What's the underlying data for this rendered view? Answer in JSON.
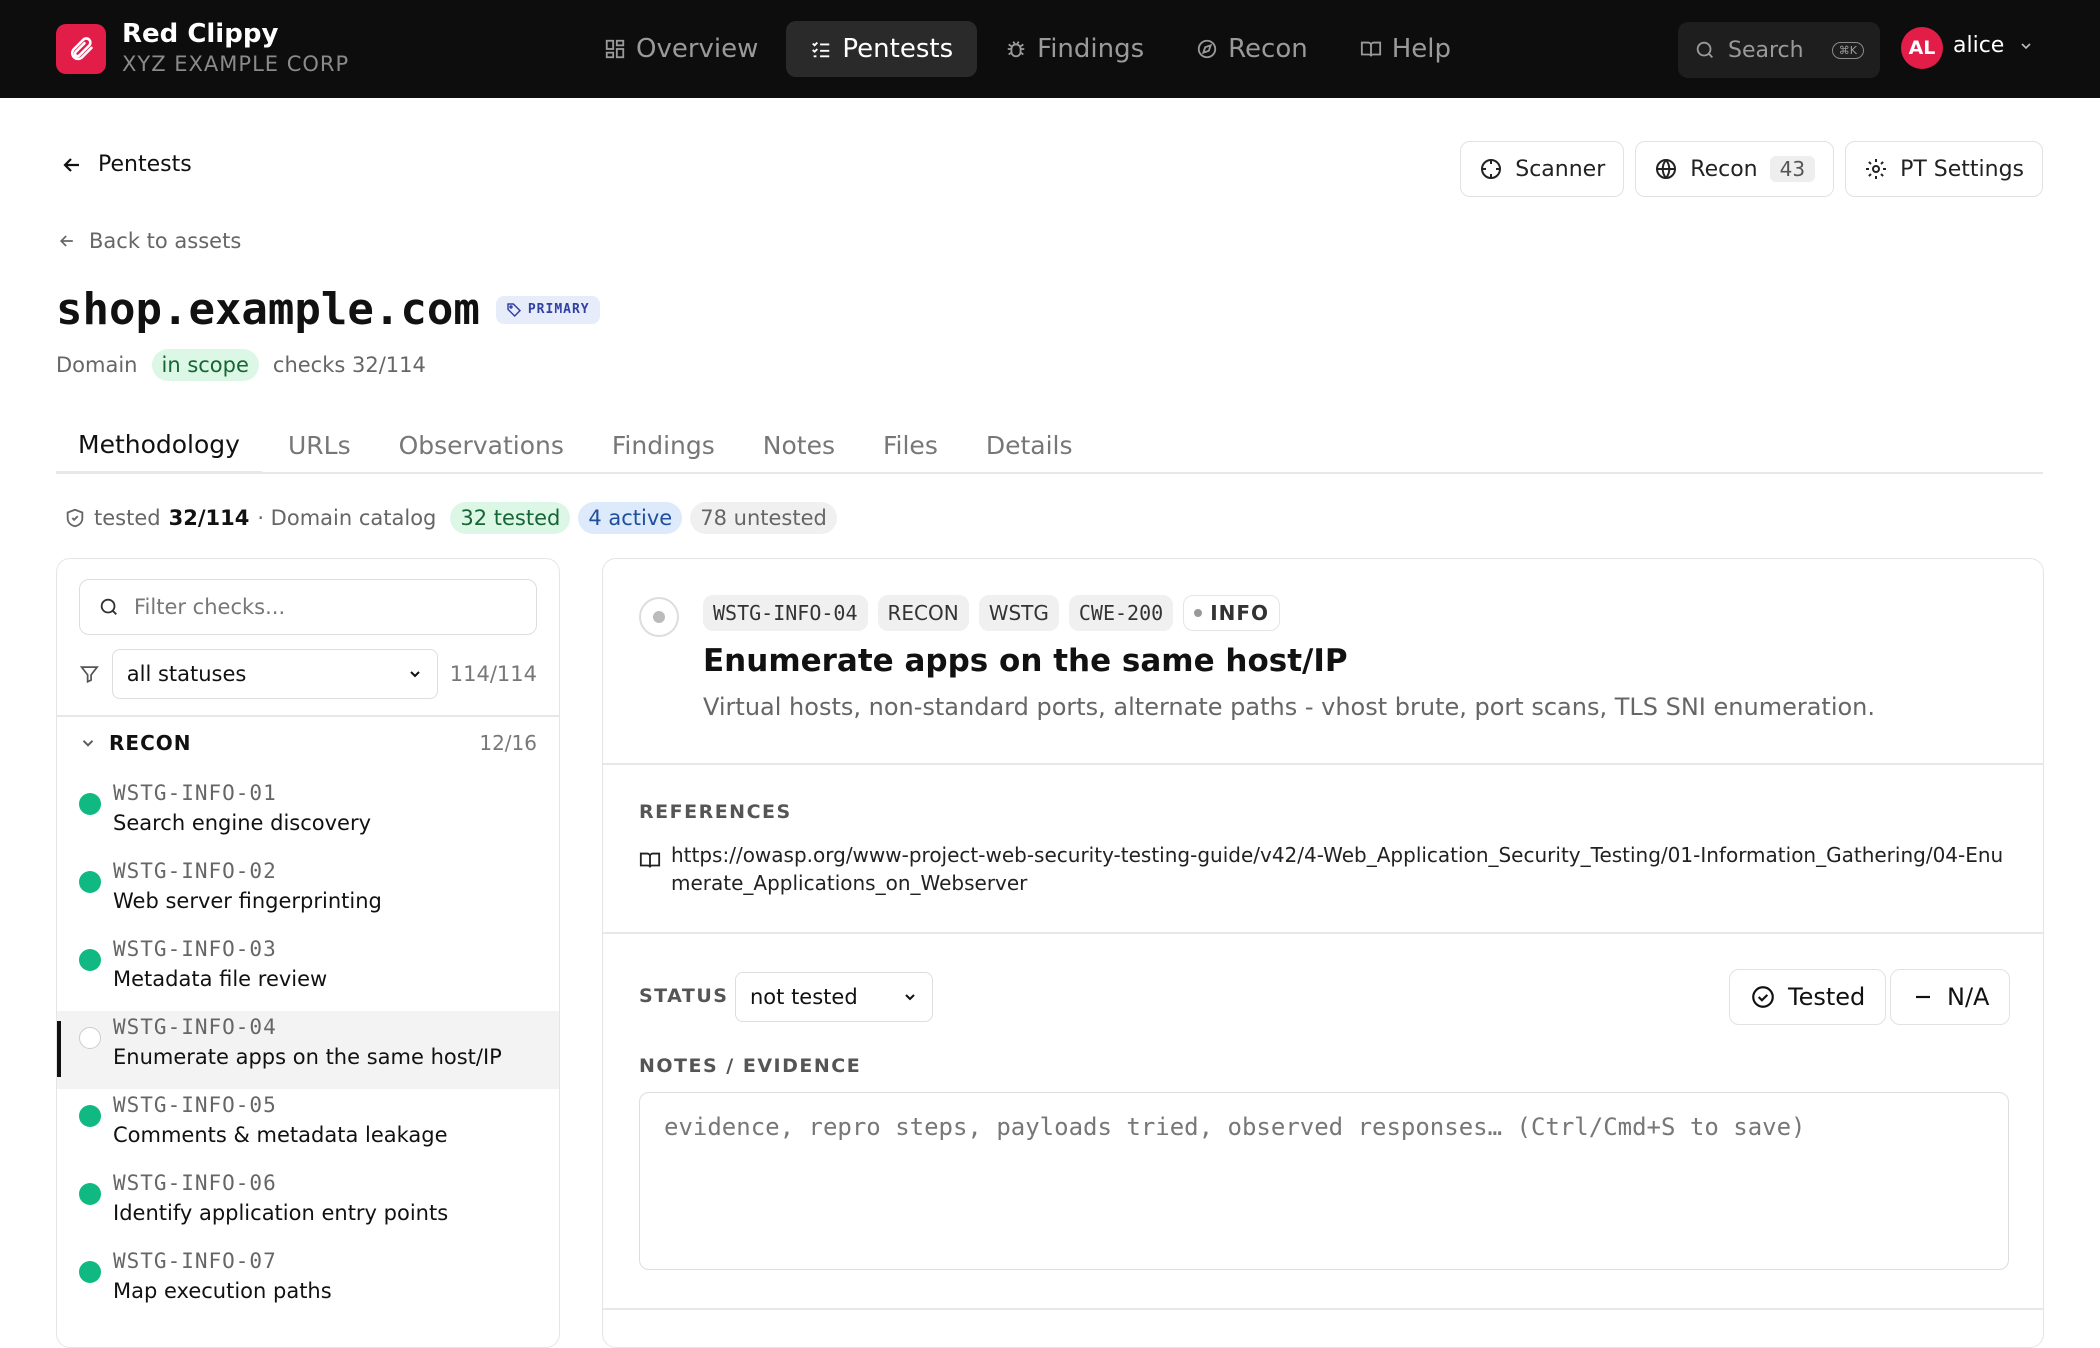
{
  "app": {
    "name": "Red Clippy",
    "org": "XYZ EXAMPLE CORP"
  },
  "nav": [
    {
      "label": "Overview",
      "icon": "grid-icon",
      "active": false
    },
    {
      "label": "Pentests",
      "icon": "checklist-icon",
      "active": true
    },
    {
      "label": "Findings",
      "icon": "bug-icon",
      "active": false
    },
    {
      "label": "Recon",
      "icon": "compass-icon",
      "active": false
    },
    {
      "label": "Help",
      "icon": "book-icon",
      "active": false
    }
  ],
  "search": {
    "label": "Search",
    "shortcut": "⌘K"
  },
  "user": {
    "initials": "AL",
    "name": "alice"
  },
  "breadcrumb": {
    "pentests": "Pentests",
    "back_assets": "Back to assets"
  },
  "header_buttons": {
    "scanner": "Scanner",
    "recon": "Recon",
    "recon_count": "43",
    "settings": "PT Settings"
  },
  "asset": {
    "name": "shop.example.com",
    "tag": "PRIMARY",
    "type": "Domain",
    "scope": "in scope",
    "checks": "checks 32/114"
  },
  "tabs": [
    "Methodology",
    "URLs",
    "Observations",
    "Findings",
    "Notes",
    "Files",
    "Details"
  ],
  "stats": {
    "tested_label": "tested",
    "tested_value": "32/114",
    "catalog": "· Domain catalog",
    "tested_pill": "32 tested",
    "active_pill": "4 active",
    "untested_pill": "78 untested"
  },
  "filter": {
    "placeholder": "Filter checks...",
    "status": "all statuses",
    "count": "114/114"
  },
  "group": {
    "name": "RECON",
    "count": "12/16"
  },
  "checks": [
    {
      "code": "WSTG-INFO-01",
      "name": "Search engine discovery",
      "done": true
    },
    {
      "code": "WSTG-INFO-02",
      "name": "Web server fingerprinting",
      "done": true
    },
    {
      "code": "WSTG-INFO-03",
      "name": "Metadata file review",
      "done": true
    },
    {
      "code": "WSTG-INFO-04",
      "name": "Enumerate apps on the same host/IP",
      "done": false
    },
    {
      "code": "WSTG-INFO-05",
      "name": "Comments & metadata leakage",
      "done": true
    },
    {
      "code": "WSTG-INFO-06",
      "name": "Identify application entry points",
      "done": true
    },
    {
      "code": "WSTG-INFO-07",
      "name": "Map execution paths",
      "done": true
    }
  ],
  "detail": {
    "chips": [
      "WSTG-INFO-04",
      "RECON",
      "WSTG",
      "CWE-200"
    ],
    "severity": "INFO",
    "title": "Enumerate apps on the same host/IP",
    "desc": "Virtual hosts, non-standard ports, alternate paths - vhost brute, port scans, TLS SNI enumeration.",
    "references_label": "REFERENCES",
    "reference": "https://owasp.org/www-project-web-security-testing-guide/v42/4-Web_Application_Security_Testing/01-Information_Gathering/04-Enumerate_Applications_on_Webserver",
    "status_label": "STATUS",
    "status": "not tested",
    "tested_btn": "Tested",
    "na_btn": "N/A",
    "notes_label": "NOTES / EVIDENCE",
    "notes_placeholder": "evidence, repro steps, payloads tried, observed responses… (Ctrl/Cmd+S to save)"
  },
  "colors": {
    "brand": "#e11d48",
    "done": "#10b981",
    "topbar": "#0d0d0d"
  }
}
